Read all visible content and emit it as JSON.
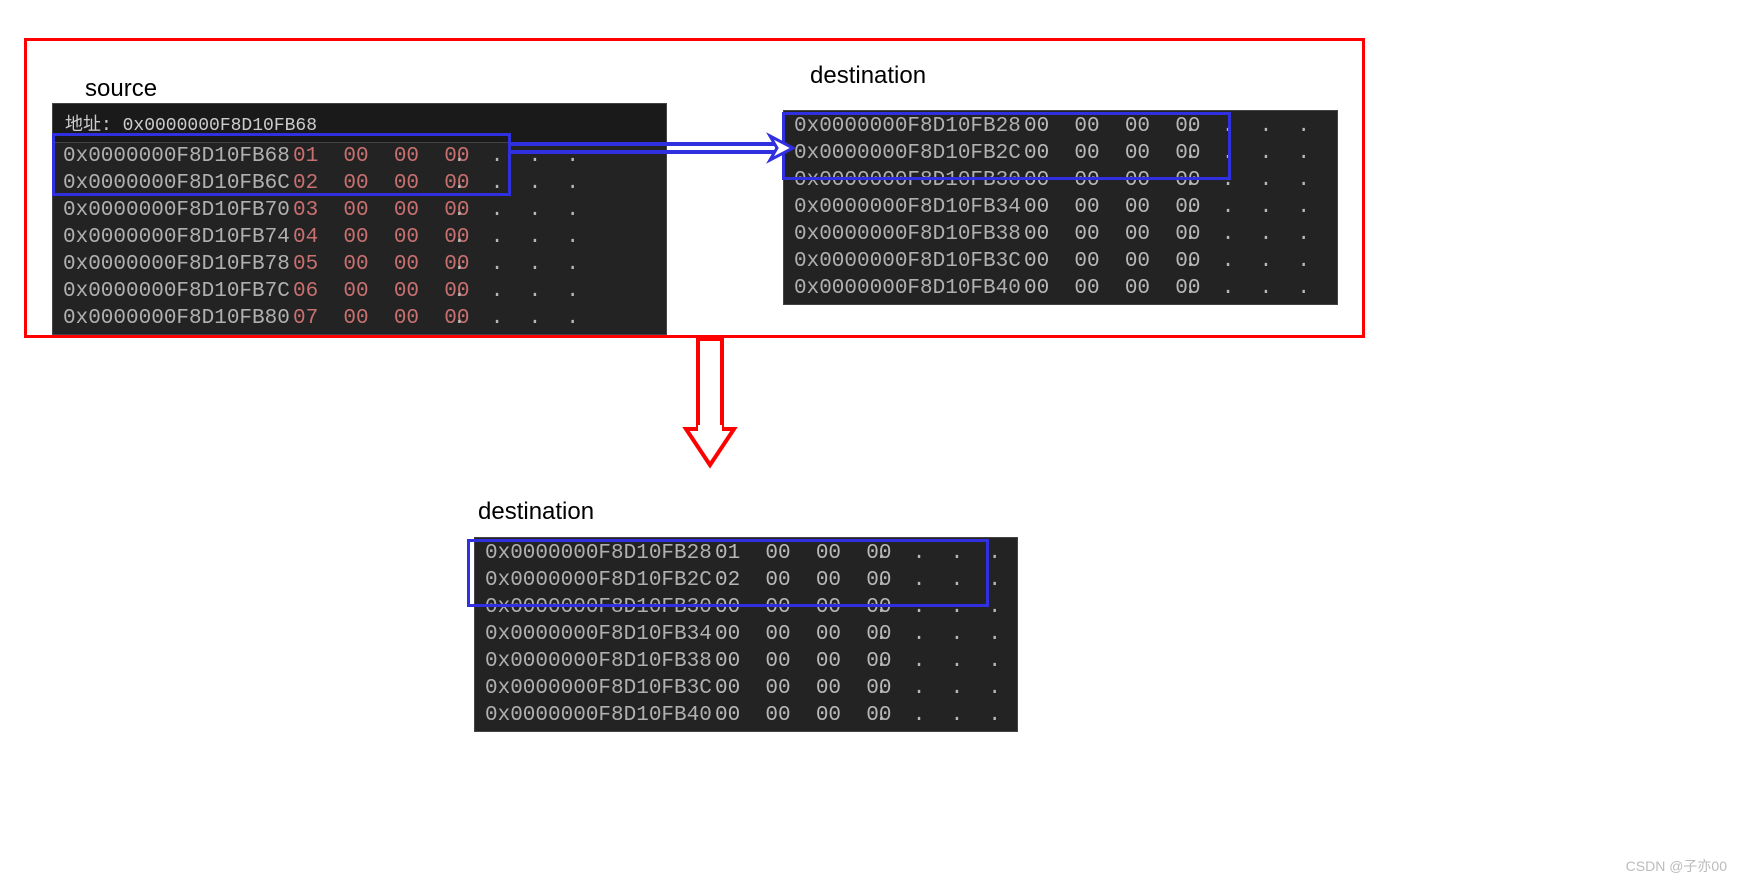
{
  "labels": {
    "source": "source",
    "destination_top": "destination",
    "destination_bottom": "destination"
  },
  "source_header": "地址: 0x0000000F8D10FB68",
  "source_rows": [
    {
      "addr": "0x0000000F8D10FB68",
      "bytes": "01  00  00  00",
      "ascii": ".  .  .  ."
    },
    {
      "addr": "0x0000000F8D10FB6C",
      "bytes": "02  00  00  00",
      "ascii": ".  .  .  ."
    },
    {
      "addr": "0x0000000F8D10FB70",
      "bytes": "03  00  00  00",
      "ascii": ".  .  .  ."
    },
    {
      "addr": "0x0000000F8D10FB74",
      "bytes": "04  00  00  00",
      "ascii": ".  .  .  ."
    },
    {
      "addr": "0x0000000F8D10FB78",
      "bytes": "05  00  00  00",
      "ascii": ".  .  .  ."
    },
    {
      "addr": "0x0000000F8D10FB7C",
      "bytes": "06  00  00  00",
      "ascii": ".  .  .  ."
    },
    {
      "addr": "0x0000000F8D10FB80",
      "bytes": "07  00  00  00",
      "ascii": ".  .  .  ."
    }
  ],
  "dest_top_rows": [
    {
      "addr": "0x0000000F8D10FB28",
      "bytes": "00  00  00  00",
      "ascii": ".  .  .  ."
    },
    {
      "addr": "0x0000000F8D10FB2C",
      "bytes": "00  00  00  00",
      "ascii": ".  .  .  ."
    },
    {
      "addr": "0x0000000F8D10FB30",
      "bytes": "00  00  00  00",
      "ascii": ".  .  .  ."
    },
    {
      "addr": "0x0000000F8D10FB34",
      "bytes": "00  00  00  00",
      "ascii": ".  .  .  ."
    },
    {
      "addr": "0x0000000F8D10FB38",
      "bytes": "00  00  00  00",
      "ascii": ".  .  .  ."
    },
    {
      "addr": "0x0000000F8D10FB3C",
      "bytes": "00  00  00  00",
      "ascii": ".  .  .  ."
    },
    {
      "addr": "0x0000000F8D10FB40",
      "bytes": "00  00  00  00",
      "ascii": ".  .  .  ."
    }
  ],
  "dest_bottom_rows": [
    {
      "addr": "0x0000000F8D10FB28",
      "bytes": "01  00  00  00",
      "ascii": ".  .  .  ."
    },
    {
      "addr": "0x0000000F8D10FB2C",
      "bytes": "02  00  00  00",
      "ascii": ".  .  .  ."
    },
    {
      "addr": "0x0000000F8D10FB30",
      "bytes": "00  00  00  00",
      "ascii": ".  .  .  ."
    },
    {
      "addr": "0x0000000F8D10FB34",
      "bytes": "00  00  00  00",
      "ascii": ".  .  .  ."
    },
    {
      "addr": "0x0000000F8D10FB38",
      "bytes": "00  00  00  00",
      "ascii": ".  .  .  ."
    },
    {
      "addr": "0x0000000F8D10FB3C",
      "bytes": "00  00  00  00",
      "ascii": ".  .  .  ."
    },
    {
      "addr": "0x0000000F8D10FB40",
      "bytes": "00  00  00  00",
      "ascii": ".  .  .  ."
    }
  ],
  "watermark": "CSDN @子亦00"
}
